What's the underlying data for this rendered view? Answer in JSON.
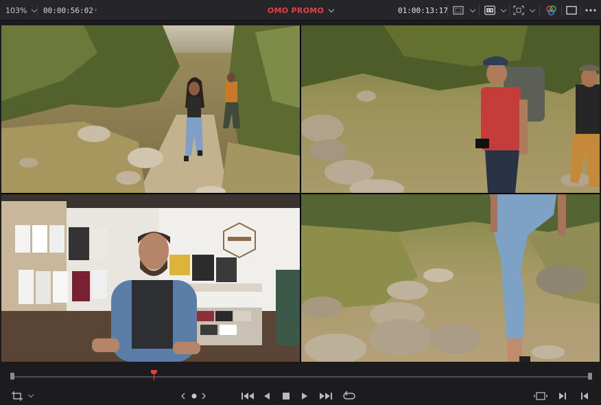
{
  "toolbar": {
    "zoom_level": "103%",
    "zoom_icon": "chevron-down-icon",
    "source_timecode": "00:00:56:02",
    "more_icon": "dots-icon",
    "timeline_name": "OMO PROMO",
    "timeline_dropdown_icon": "chevron-down-icon",
    "record_timecode": "01:00:13:17",
    "icons": [
      "safe-area-icon",
      "hd-quality-icon",
      "transform-icon",
      "color-wheel-icon",
      "single-viewer-icon",
      "options-icon"
    ]
  },
  "viewer": {
    "layout": "multicam-2x2",
    "angles": [
      "angle-1-trail-hiker",
      "angle-2-hikers-talking",
      "angle-3-shop-interview",
      "angle-4-trail-closeup"
    ]
  },
  "scrubber": {
    "playhead_fraction": 0.245
  },
  "transport": {
    "icons": [
      "aspect-icon",
      "chevron-down-icon",
      "prev-clip-icon",
      "jog-dot-icon",
      "next-clip-icon",
      "go-to-start-icon",
      "reverse-play-icon",
      "stop-icon",
      "play-icon",
      "go-to-end-icon",
      "loop-icon",
      "match-frame-icon",
      "mark-in-icon",
      "mark-out-icon"
    ]
  },
  "colors": {
    "accent": "#e8403e",
    "bar": "#26262a",
    "background": "#1c1c1e"
  }
}
